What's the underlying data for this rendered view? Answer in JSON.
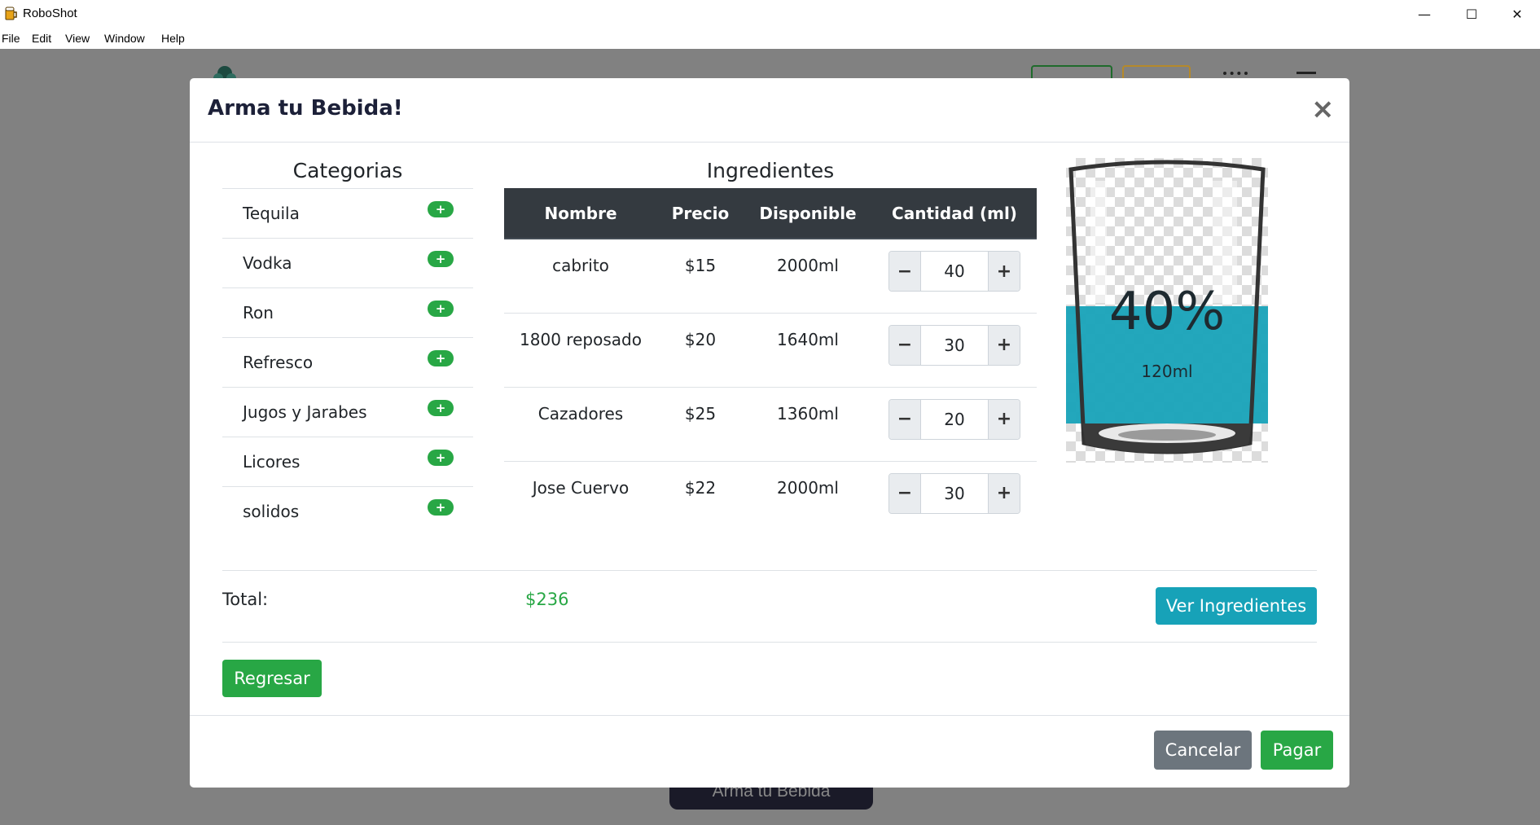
{
  "window": {
    "title": "RoboShot",
    "minimize_glyph": "—",
    "maximize_glyph": "☐",
    "close_glyph": "✕"
  },
  "menu": [
    "File",
    "Edit",
    "View",
    "Window",
    "Help"
  ],
  "background": {
    "main_button": "Arma tu Bebida"
  },
  "modal": {
    "title": "Arma tu Bebida!",
    "close_glyph": "×",
    "categories": {
      "title": "Categorias",
      "add_glyph": "+",
      "items": [
        "Tequila",
        "Vodka",
        "Ron",
        "Refresco",
        "Jugos y Jarabes",
        "Licores",
        "solidos"
      ]
    },
    "ingredients": {
      "title": "Ingredientes",
      "headers": [
        "Nombre",
        "Precio",
        "Disponible",
        "Cantidad (ml)"
      ],
      "minus_glyph": "−",
      "plus_glyph": "+",
      "rows": [
        {
          "name": "cabrito",
          "price": "$15",
          "available": "2000ml",
          "qty": "40"
        },
        {
          "name": "1800 reposado",
          "price": "$20",
          "available": "1640ml",
          "qty": "30"
        },
        {
          "name": "Cazadores",
          "price": "$25",
          "available": "1360ml",
          "qty": "20"
        },
        {
          "name": "Jose Cuervo",
          "price": "$22",
          "available": "2000ml",
          "qty": "30"
        }
      ]
    },
    "glass": {
      "percent_label": "40%",
      "volume_label": "120ml",
      "fill_fraction": 0.4,
      "liquid_color": "#17a2b8"
    },
    "total": {
      "label": "Total:",
      "value": "$236"
    },
    "buttons": {
      "ver_ingredientes": "Ver Ingredientes",
      "regresar": "Regresar",
      "cancelar": "Cancelar",
      "pagar": "Pagar"
    }
  },
  "colors": {
    "success": "#28a745",
    "info": "#17a2b8",
    "secondary": "#6c757d",
    "table_header": "#343a40",
    "backdrop": "#818181"
  }
}
